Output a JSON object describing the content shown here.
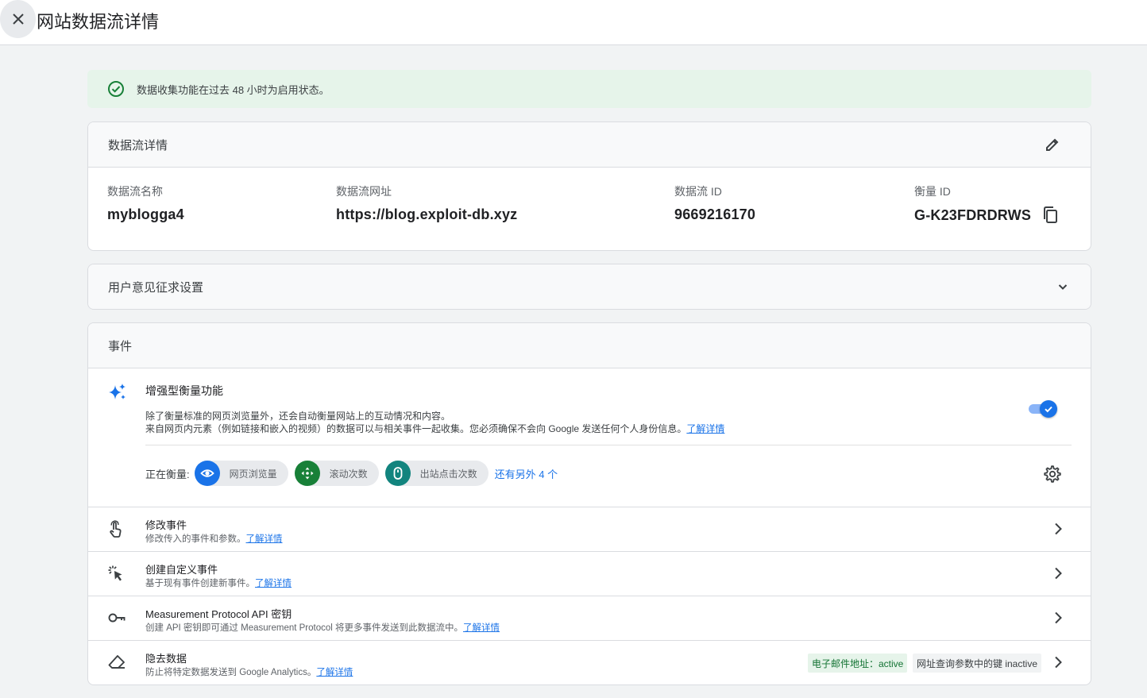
{
  "header": {
    "title": "网站数据流详情"
  },
  "alert": {
    "text": "数据收集功能在过去 48 小时为启用状态。"
  },
  "stream_card": {
    "title": "数据流详情",
    "fields": [
      {
        "label": "数据流名称",
        "value": "myblogga4"
      },
      {
        "label": "数据流网址",
        "value": "https://blog.exploit-db.xyz"
      },
      {
        "label": "数据流 ID",
        "value": "9669216170"
      },
      {
        "label": "衡量 ID",
        "value": "G-K23FDRDRWS"
      }
    ]
  },
  "consent_card": {
    "title": "用户意见征求设置"
  },
  "events_card": {
    "title": "事件",
    "enhanced": {
      "title": "增强型衡量功能",
      "desc_line1": "除了衡量标准的网页浏览量外，还会自动衡量网站上的互动情况和内容。",
      "desc_line2": "来自网页内元素（例如链接和嵌入的视频）的数据可以与相关事件一起收集。您必须确保不会向 Google 发送任何个人身份信息。",
      "learn_more": "了解详情",
      "measuring_label": "正在衡量:",
      "chips": [
        {
          "label": "网页浏览量",
          "color": "#1a73e8",
          "icon": "eye-icon"
        },
        {
          "label": "滚动次数",
          "color": "#188038",
          "icon": "scroll-icon"
        },
        {
          "label": "出站点击次数",
          "color": "#12847e",
          "icon": "mouse-icon"
        }
      ],
      "more": "还有另外 4 个",
      "toggle_on": true
    },
    "rows": [
      {
        "title": "修改事件",
        "desc": "修改传入的事件和参数。",
        "link": "了解详情",
        "icon": "touch-icon"
      },
      {
        "title": "创建自定义事件",
        "desc": "基于现有事件创建新事件。",
        "link": "了解详情",
        "icon": "click-icon"
      },
      {
        "title": "Measurement Protocol API 密钥",
        "desc": "创建 API 密钥即可通过 Measurement Protocol 将更多事件发送到此数据流中。",
        "link": "了解详情",
        "icon": "key-icon"
      },
      {
        "title": "隐去数据",
        "desc": "防止将特定数据发送到 Google Analytics。",
        "link": "了解详情",
        "icon": "eraser-icon",
        "badges": [
          "电子邮件地址：active",
          "网址查询参数中的键 inactive"
        ]
      }
    ]
  },
  "colors": {
    "accent": "#1a73e8",
    "success": "#188038",
    "alert_bg": "#e6f4ea"
  }
}
